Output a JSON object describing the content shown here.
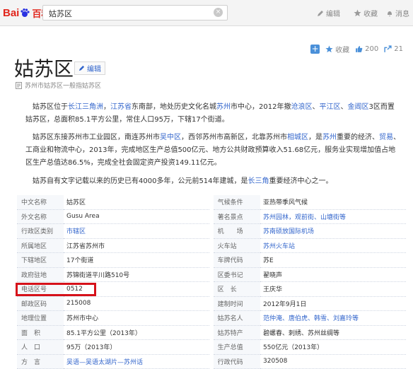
{
  "header": {
    "logo_bai": "Bai",
    "logo_du": "du",
    "logo_baike": "百科",
    "search_value": "姑苏区",
    "nav_edit": "编辑",
    "nav_favorite": "收藏",
    "nav_message": "消息"
  },
  "article": {
    "title": "姑苏区",
    "edit_label": "编辑",
    "subtitle": "苏州市姑苏区一般指姑苏区",
    "actions": {
      "favorite": "收藏",
      "likes": "200",
      "shares": "21"
    },
    "paragraphs": [
      [
        {
          "t": "姑苏区位于"
        },
        {
          "t": "长江三角洲",
          "link": true
        },
        {
          "t": "，"
        },
        {
          "t": "江苏省",
          "link": true
        },
        {
          "t": "东南部，地处历史文化名城"
        },
        {
          "t": "苏州",
          "link": true
        },
        {
          "t": "市中心，2012年撤"
        },
        {
          "t": "沧浪区",
          "link": true
        },
        {
          "t": "、"
        },
        {
          "t": "平江区",
          "link": true
        },
        {
          "t": "、"
        },
        {
          "t": "金阊区",
          "link": true
        },
        {
          "t": "3区而置姑苏区，总面积85.1平方公里，常住人口95万，下辖17个街道。"
        }
      ],
      [
        {
          "t": "姑苏区东接苏州市工业园区，南连苏州市"
        },
        {
          "t": "吴中区",
          "link": true
        },
        {
          "t": "，西邻苏州市高新区，北靠苏州市"
        },
        {
          "t": "相城区",
          "link": true
        },
        {
          "t": "，是"
        },
        {
          "t": "苏州",
          "link": true
        },
        {
          "t": "重要的经济、"
        },
        {
          "t": "贸易",
          "link": true
        },
        {
          "t": "、工商业和物流中心，2013年，完成地区生产总值500亿元、地方公共财政预算收入51.68亿元，服务业实现增加值占地区生产总值达86.5%，完成全社会固定资产投资149.11亿元。"
        }
      ],
      [
        {
          "t": "姑苏自有文字记载以来的历史已有4000多年，公元前514年建城，是"
        },
        {
          "t": "长三角",
          "link": true
        },
        {
          "t": "重要经济中心之一。"
        }
      ]
    ]
  },
  "infobox": {
    "rows": [
      {
        "l1": "中文名称",
        "v1": "姑苏区",
        "link1": false,
        "l2": "气候条件",
        "v2": "亚热带季风气候",
        "link2": false
      },
      {
        "l1": "外文名称",
        "v1": "Gusu Area",
        "link1": false,
        "l2": "著名景点",
        "v2": "苏州园林，观前街、山塘街等",
        "link2": true
      },
      {
        "l1": "行政区类别",
        "v1": "市辖区",
        "link1": true,
        "l2": "机　　场",
        "v2": "苏南硕放国际机场",
        "link2": true
      },
      {
        "l1": "所属地区",
        "v1": "江苏省苏州市",
        "link1": false,
        "l2": "火车站",
        "v2": "苏州火车站",
        "link2": true
      },
      {
        "l1": "下辖地区",
        "v1": "17个街道",
        "link1": false,
        "l2": "车牌代码",
        "v2": "苏E",
        "link2": false
      },
      {
        "l1": "政府驻地",
        "v1": "苏锦街道平川路510号",
        "link1": false,
        "l2": "区委书记",
        "v2": "翟晓声",
        "link2": false
      },
      {
        "l1": "电话区号",
        "v1": "0512",
        "link1": false,
        "l2": "区　长",
        "v2": "王庆华",
        "link2": false
      },
      {
        "l1": "邮政区码",
        "v1": "215008",
        "link1": false,
        "l2": "建制时间",
        "v2": "2012年9月1日",
        "link2": false
      },
      {
        "l1": "地理位置",
        "v1": "苏州市中心",
        "link1": false,
        "l2": "姑苏名人",
        "v2": "范仲淹、唐伯虎、韩雪、刘嘉玲等",
        "link2": true
      },
      {
        "l1": "面　积",
        "v1": "85.1平方公里（2013年）",
        "link1": false,
        "l2": "姑苏特产",
        "v2": "碧螺春、刺绣、苏州丝绸等",
        "link2": false
      },
      {
        "l1": "人　口",
        "v1": "95万（2013年）",
        "link1": false,
        "l2": "生产总值",
        "v2": "550亿元（2013年）",
        "link2": false
      },
      {
        "l1": "方　言",
        "v1": "吴语—吴语太湖片—苏州话",
        "link1": true,
        "l2": "行政代码",
        "v2": "320508",
        "link2": false
      }
    ]
  },
  "colors": {
    "accent": "#3366cc",
    "highlight_box": "#d6111a",
    "logo": "#e1251b"
  }
}
